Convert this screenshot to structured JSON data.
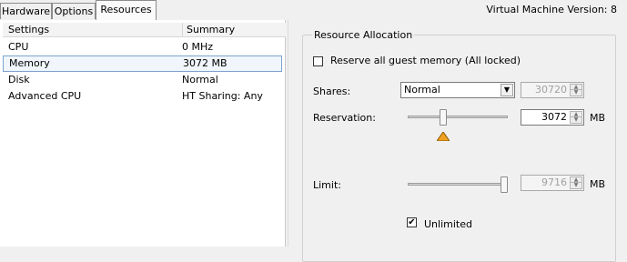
{
  "tabs": [
    {
      "label": "Hardware"
    },
    {
      "label": "Options"
    },
    {
      "label": "Resources"
    }
  ],
  "vm_version": "Virtual Machine Version: 8",
  "settings_table": {
    "columns": [
      "Settings",
      "Summary"
    ],
    "rows": [
      {
        "setting": "CPU",
        "summary": "0 MHz"
      },
      {
        "setting": "Memory",
        "summary": "3072 MB"
      },
      {
        "setting": "Disk",
        "summary": "Normal"
      },
      {
        "setting": "Advanced CPU",
        "summary": "HT Sharing: Any"
      }
    ],
    "selected_row": "Memory"
  },
  "resource_allocation": {
    "title": "Resource Allocation",
    "reserve_all": {
      "label": "Reserve all guest memory (All locked)",
      "checked": false
    },
    "shares": {
      "label": "Shares:",
      "value": "Normal",
      "number": "30720"
    },
    "reservation": {
      "label": "Reservation:",
      "value": "3072",
      "unit": "MB",
      "slider_fraction": 0.34,
      "warning_color": "#f0a020"
    },
    "limit": {
      "label": "Limit:",
      "value": "9716",
      "unit": "MB",
      "slider_fraction": 1.0
    },
    "unlimited": {
      "label": "Unlimited",
      "checked": true,
      "check_glyph": "✔"
    }
  }
}
